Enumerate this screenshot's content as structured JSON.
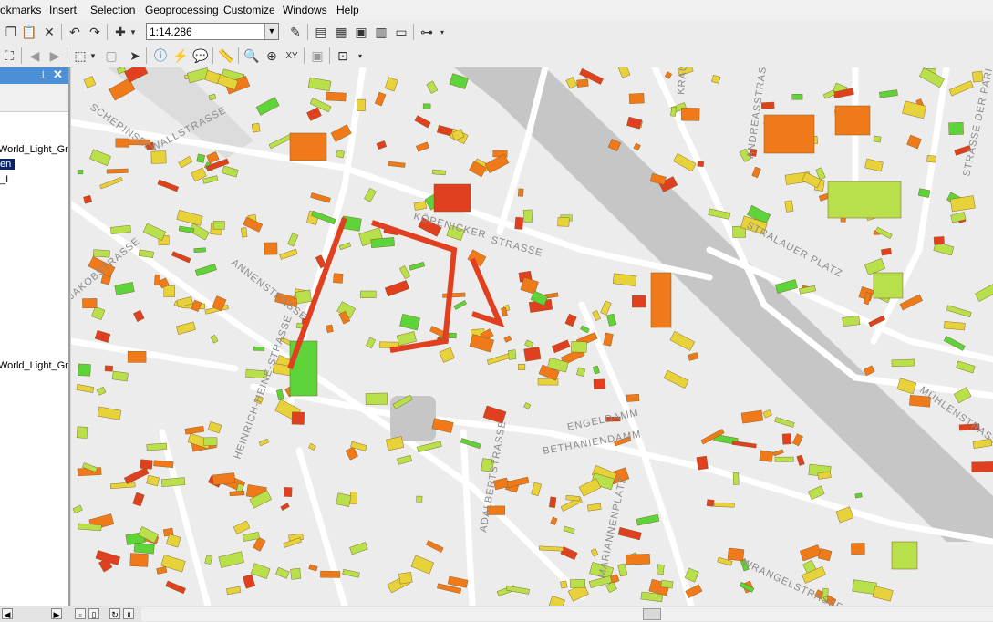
{
  "menu": [
    "okmarks",
    "Insert",
    "Selection",
    "Geoprocessing",
    "Customize",
    "Windows",
    "Help"
  ],
  "toolbar": {
    "scale_value": "1:14.286"
  },
  "toc": {
    "items": [
      "World_Light_Gr",
      "en",
      "_I",
      "World_Light_Gr"
    ],
    "selected_index": 1
  },
  "map": {
    "street_labels": [
      "SCHEPINSEL",
      "WALLSTRASSE",
      "KÖPENICKER",
      "STRASSE",
      "JAKOBSTRASSE",
      "ANNENSTRASSE",
      "HEINRICH-HEINE-STRASSE",
      "ENGELDAMM",
      "BETHANIENDAMM",
      "ADALBERTSTRASSE",
      "MARIANNENPLATZ",
      "WRANGELSTRASSE",
      "STRALAUER PLATZ",
      "MÜHLENSTRASSE",
      "ANDREASSTRASSE",
      "STRASSE DER PARISER",
      "KRAUTSTR"
    ]
  },
  "colors": {
    "building_red": "#e0401f",
    "building_orange": "#f07a1a",
    "building_yellow": "#e8d23a",
    "building_lightgreen": "#b8e04a",
    "building_green": "#5cd43a",
    "water": "#c6c6c6",
    "road": "#ffffff",
    "panel_header": "#4b8fd6"
  }
}
